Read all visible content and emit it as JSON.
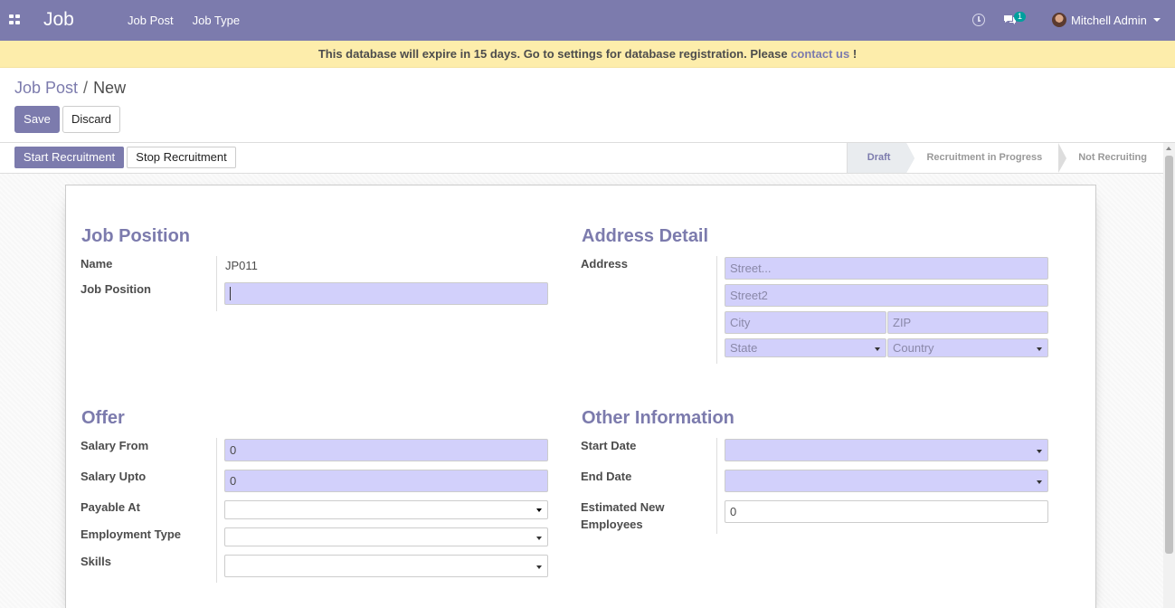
{
  "navbar": {
    "app_name": "Job",
    "menu": [
      "Job Post",
      "Job Type"
    ],
    "chat_count": "1",
    "user_name": "Mitchell Admin"
  },
  "warning": {
    "text": "This database will expire in 15 days. Go to settings for database registration. Please",
    "link": "contact us",
    "suffix": "!"
  },
  "breadcrumb": {
    "parent": "Job Post",
    "separator": "/",
    "current": "New"
  },
  "buttons": {
    "save": "Save",
    "discard": "Discard",
    "start_recruitment": "Start Recruitment",
    "stop_recruitment": "Stop Recruitment"
  },
  "stages": {
    "draft": "Draft",
    "in_progress": "Recruitment in Progress",
    "not_recruiting": "Not Recruiting",
    "active": "Draft"
  },
  "job_position": {
    "title": "Job Position",
    "name_label": "Name",
    "name_value": "JP011",
    "position_label": "Job Position",
    "position_value": ""
  },
  "address": {
    "title": "Address Detail",
    "label": "Address",
    "street_ph": "Street...",
    "street2_ph": "Street2",
    "city_ph": "City",
    "zip_ph": "ZIP",
    "state_ph": "State",
    "country_ph": "Country"
  },
  "offer": {
    "title": "Offer",
    "salary_from_label": "Salary From",
    "salary_from": "0",
    "salary_upto_label": "Salary Upto",
    "salary_upto": "0",
    "payable_at_label": "Payable At",
    "employment_type_label": "Employment Type",
    "skills_label": "Skills"
  },
  "other": {
    "title": "Other Information",
    "start_date_label": "Start Date",
    "end_date_label": "End Date",
    "est_label_line1": "Estimated New",
    "est_label_line2": "Employees",
    "est_value": "0"
  },
  "colors": {
    "brand": "#7c7bad",
    "required_field": "#d2d0fb",
    "warning_bg": "#fdedab"
  }
}
